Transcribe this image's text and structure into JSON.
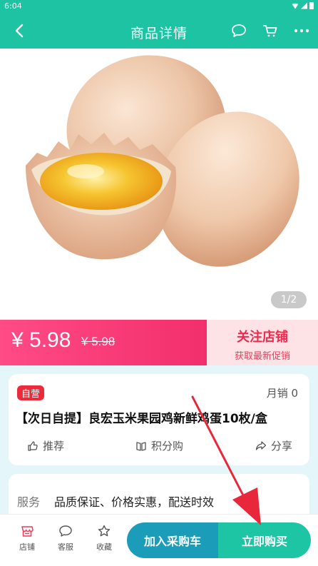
{
  "status_bar": {
    "time": "6:04"
  },
  "app_bar": {
    "title": "商品详情",
    "back_icon": "back-arrow-icon",
    "actions": [
      "chat-bubble-icon",
      "cart-icon",
      "more-icon"
    ]
  },
  "gallery": {
    "indicator": "1/2"
  },
  "price": {
    "current": "¥ 5.98",
    "original": "¥ 5.98"
  },
  "follow_store": {
    "title": "关注店铺",
    "subtitle": "获取最新促销"
  },
  "product": {
    "tag": "自营",
    "monthly_sales": "月销 0",
    "title": "【次日自提】良宏玉米果园鸡新鲜鸡蛋10枚/盒",
    "actions": {
      "recommend": "推荐",
      "points": "积分购",
      "share": "分享"
    }
  },
  "service": {
    "label": "服务",
    "text": "品质保证、价格实惠，配送时效"
  },
  "bottom_bar": {
    "store": "店铺",
    "support": "客服",
    "favorite": "收藏",
    "add_cart": "加入采购车",
    "buy_now": "立即购买"
  },
  "colors": {
    "brand": "#1dc3a3",
    "price_pink": "#f22f6c",
    "cta_blue": "#1b9db9",
    "annotation_red": "#e8283a"
  }
}
